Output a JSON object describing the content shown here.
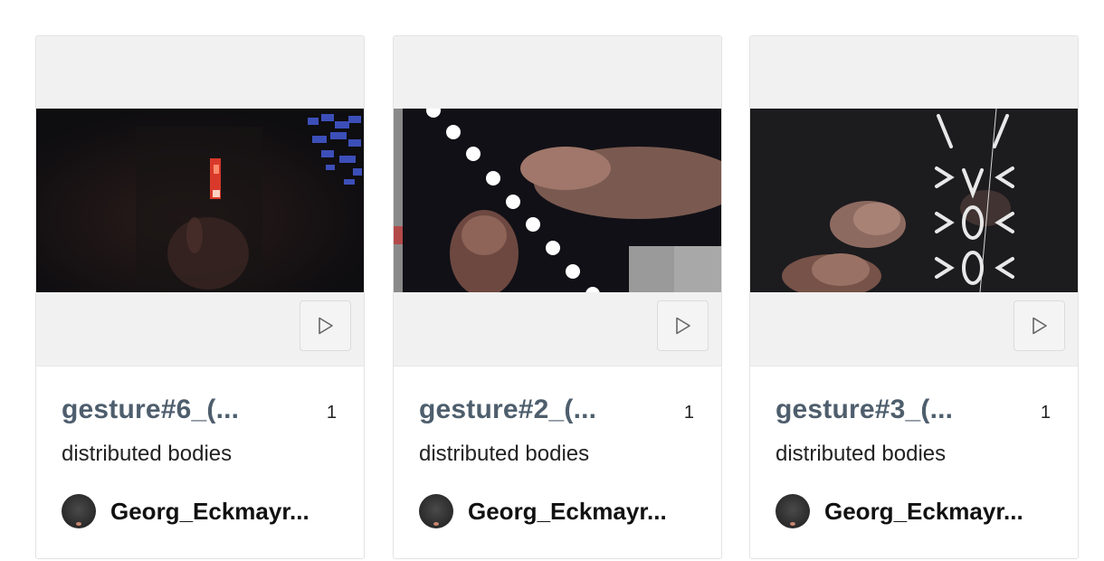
{
  "items": [
    {
      "title": "gesture#6_(...",
      "count": "1",
      "collection": "distributed bodies",
      "uploader": "Georg_Eckmayr...",
      "play_icon": "play-icon"
    },
    {
      "title": "gesture#2_(...",
      "count": "1",
      "collection": "distributed bodies",
      "uploader": "Georg_Eckmayr...",
      "play_icon": "play-icon"
    },
    {
      "title": "gesture#3_(...",
      "count": "1",
      "collection": "distributed bodies",
      "uploader": "Georg_Eckmayr...",
      "play_icon": "play-icon"
    }
  ],
  "colors": {
    "title": "#4e5e6d",
    "card_border": "#e3e3e3",
    "media_bg": "#f1f1f1"
  }
}
